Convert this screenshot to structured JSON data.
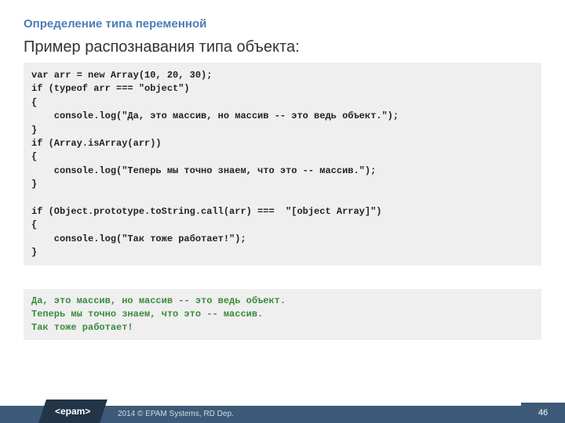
{
  "header": {
    "title": "Определение типа переменной",
    "subtitle": "Пример распознавания типа объекта:"
  },
  "code": {
    "l1": "var arr = new Array(10, 20, 30);",
    "l2": "if (typeof arr === \"object\")",
    "l3": "{",
    "l4": "    console.log(\"Да, это массив, но массив -- это ведь объект.\");",
    "l5": "}",
    "l6": "if (Array.isArray(arr))",
    "l7": "{",
    "l8": "    console.log(\"Теперь мы точно знаем, что это -- массив.\");",
    "l9": "}",
    "l10": "",
    "l11": "if (Object.prototype.toString.call(arr) ===  \"[object Array]\")",
    "l12": "{",
    "l13": "    console.log(\"Так тоже работает!\");",
    "l14": "}"
  },
  "output": {
    "l1": "Да, это массив, но массив -- это ведь объект.",
    "l2": "Теперь мы точно знаем, что это -- массив.",
    "l3": "Так тоже работает!"
  },
  "footer": {
    "logo": "<epam>",
    "copyright": "2014 © EPAM Systems, RD Dep.",
    "page": "46"
  }
}
